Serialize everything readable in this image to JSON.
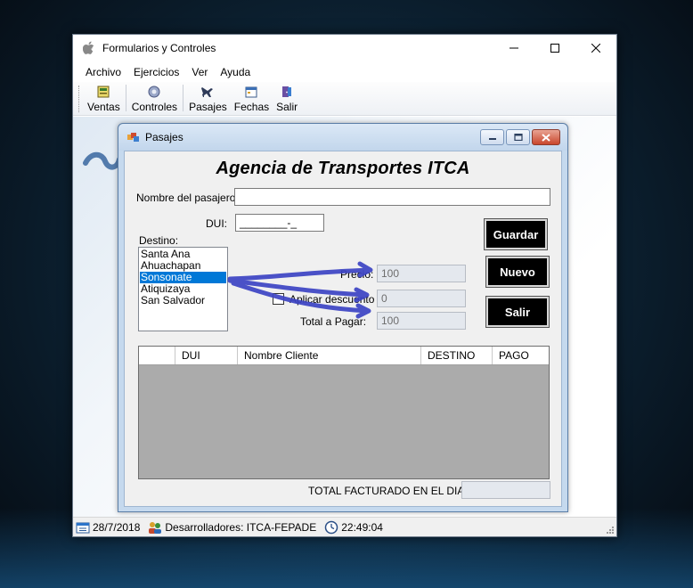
{
  "window": {
    "title": "Formularios y Controles"
  },
  "menu": [
    "Archivo",
    "Ejercicios",
    "Ver",
    "Ayuda"
  ],
  "toolbar": {
    "items": [
      {
        "label": "Ventas",
        "icon": "ventas-icon"
      },
      {
        "label": "Controles",
        "icon": "controles-icon"
      },
      {
        "label": "Pasajes",
        "icon": "airplane-icon"
      },
      {
        "label": "Fechas",
        "icon": "calendar-icon"
      },
      {
        "label": "Salir",
        "icon": "exit-icon"
      }
    ]
  },
  "child": {
    "title": "Pasajes",
    "heading": "Agencia de Transportes ITCA",
    "nombre_label": "Nombre del pasajero:",
    "nombre_value": "",
    "dui_label": "DUI:",
    "dui_mask": "________-_",
    "destino_label": "Destino:",
    "destinos": [
      "Santa Ana",
      "Ahuachapan",
      "Sonsonate",
      "Atiquizaya",
      "San Salvador"
    ],
    "selected_destino": "Sonsonate",
    "precio_label": "Precio:",
    "precio_value": "100",
    "descuento_label": "Aplicar descuento",
    "descuento_checked": false,
    "descuento_value": "0",
    "total_label": "Total a Pagar:",
    "total_value": "100",
    "buttons": {
      "guardar": "Guardar",
      "nuevo": "Nuevo",
      "salir": "Salir"
    },
    "grid_columns": [
      "",
      "DUI",
      "Nombre Cliente",
      "DESTINO",
      "PAGO"
    ],
    "total_dia_label": "TOTAL FACTURADO EN EL DIA:",
    "total_dia_value": ""
  },
  "status": {
    "date": "28/7/2018",
    "developers": "Desarrolladores: ITCA-FEPADE",
    "time": "22:49:04"
  },
  "colors": {
    "selection": "#0078d7",
    "annotation": "#3d44c4",
    "grid_bg": "#ababab"
  }
}
